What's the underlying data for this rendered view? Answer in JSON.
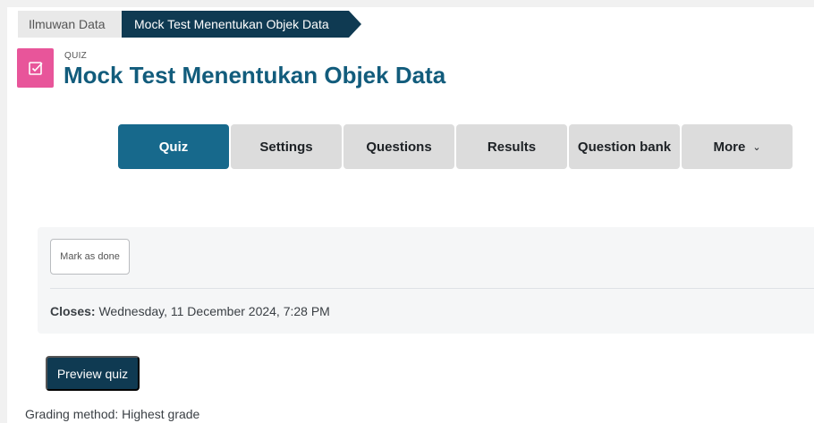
{
  "breadcrumb": {
    "parent": "Ilmuwan Data",
    "current": "Mock Test Menentukan Objek Data"
  },
  "header": {
    "kicker": "QUIZ",
    "title": "Mock Test Menentukan Objek Data",
    "icon": "quiz-checkbox-icon",
    "icon_color": "#e8559a",
    "title_color": "#125c7c"
  },
  "tabs": [
    {
      "label": "Quiz",
      "active": true
    },
    {
      "label": "Settings",
      "active": false
    },
    {
      "label": "Questions",
      "active": false
    },
    {
      "label": "Results",
      "active": false
    },
    {
      "label": "Question bank",
      "active": false
    },
    {
      "label": "More",
      "active": false,
      "icon": "chevron-down-icon"
    }
  ],
  "activity": {
    "mark_done_label": "Mark as done",
    "closes_label": "Closes:",
    "closes_value": "Wednesday, 11 December 2024, 7:28 PM"
  },
  "actions": {
    "preview_label": "Preview quiz"
  },
  "grading": {
    "text": "Grading method: Highest grade"
  },
  "colors": {
    "primary_dark": "#0f3a52",
    "tab_active": "#17698c",
    "tab_inactive": "#dcdcdc"
  }
}
